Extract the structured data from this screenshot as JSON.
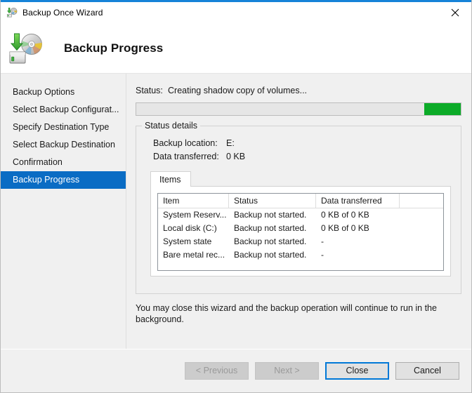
{
  "window": {
    "title": "Backup Once Wizard",
    "titlebar_icon": "backup-disk-icon",
    "close_icon": "close-icon",
    "accent_color": "#1683d8"
  },
  "header": {
    "icon": "backup-disk-large-icon",
    "title": "Backup Progress"
  },
  "sidebar": {
    "items": [
      {
        "label": "Backup Options",
        "selected": false
      },
      {
        "label": "Select Backup Configurat...",
        "selected": false
      },
      {
        "label": "Specify Destination Type",
        "selected": false
      },
      {
        "label": "Select Backup Destination",
        "selected": false
      },
      {
        "label": "Confirmation",
        "selected": false
      },
      {
        "label": "Backup Progress",
        "selected": true
      }
    ],
    "selected_color": "#0a6cc4"
  },
  "main": {
    "status": {
      "label": "Status:",
      "value": "Creating shadow copy of volumes..."
    },
    "progress": {
      "style": "marquee",
      "chunk_color": "#0cab28",
      "track_color": "#e6e6e6"
    },
    "status_details": {
      "legend": "Status details",
      "backup_location_label": "Backup location:",
      "backup_location_value": "E:",
      "data_transferred_label": "Data transferred:",
      "data_transferred_value": "0 KB"
    },
    "tabs": [
      {
        "label": "Items",
        "selected": true
      }
    ],
    "table": {
      "columns": [
        "Item",
        "Status",
        "Data transferred",
        ""
      ],
      "rows": [
        [
          "System Reserv...",
          "Backup not started.",
          "0 KB of 0 KB",
          ""
        ],
        [
          "Local disk (C:)",
          "Backup not started.",
          "0 KB of 0 KB",
          ""
        ],
        [
          "System state",
          "Backup not started.",
          "-",
          ""
        ],
        [
          "Bare metal rec...",
          "Backup not started.",
          "-",
          ""
        ]
      ]
    },
    "note": "You may close this wizard and the backup operation will continue to run in the background."
  },
  "footer": {
    "buttons": [
      {
        "label": "< Previous",
        "state": "disabled"
      },
      {
        "label": "Next >",
        "state": "disabled"
      },
      {
        "label": "Close",
        "state": "default"
      },
      {
        "label": "Cancel",
        "state": "normal"
      }
    ]
  }
}
